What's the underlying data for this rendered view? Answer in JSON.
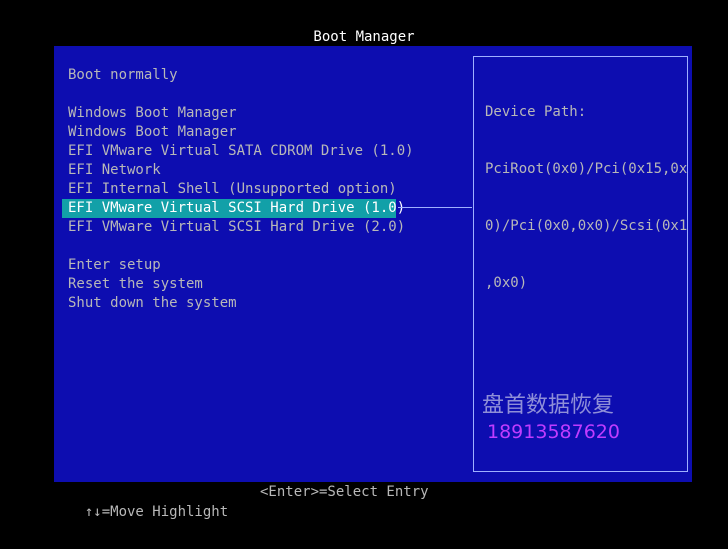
{
  "window": {
    "title": "Boot Manager"
  },
  "menu": {
    "items": [
      {
        "label": "Boot normally"
      },
      {
        "label": ""
      },
      {
        "label": "Windows Boot Manager"
      },
      {
        "label": "Windows Boot Manager"
      },
      {
        "label": "EFI VMware Virtual SATA CDROM Drive (1.0)"
      },
      {
        "label": "EFI Network"
      },
      {
        "label": "EFI Internal Shell (Unsupported option)"
      },
      {
        "label": "EFI VMware Virtual SCSI Hard Drive (1.0)",
        "selected": true
      },
      {
        "label": "EFI VMware Virtual SCSI Hard Drive (2.0)"
      },
      {
        "label": ""
      },
      {
        "label": "Enter setup"
      },
      {
        "label": "Reset the system"
      },
      {
        "label": "Shut down the system"
      }
    ]
  },
  "info": {
    "lines": [
      "Device Path:",
      "PciRoot(0x0)/Pci(0x15,0x",
      "0)/Pci(0x0,0x0)/Scsi(0x1",
      ",0x0)"
    ]
  },
  "watermark": {
    "name": "盘首数据恢复",
    "phone": "18913587620"
  },
  "footer": {
    "hint_move": "↑↓=Move Highlight",
    "hint_select": "<Enter>=Select Entry"
  },
  "colors": {
    "background": "#000000",
    "panel": "#0d0db0",
    "highlight": "#12a0a8",
    "text": "#b8b8b8",
    "title_text": "#ffffff",
    "border": "#9fb0ff",
    "watermark_name": "#8f8fd8",
    "watermark_phone": "#c03cff"
  }
}
